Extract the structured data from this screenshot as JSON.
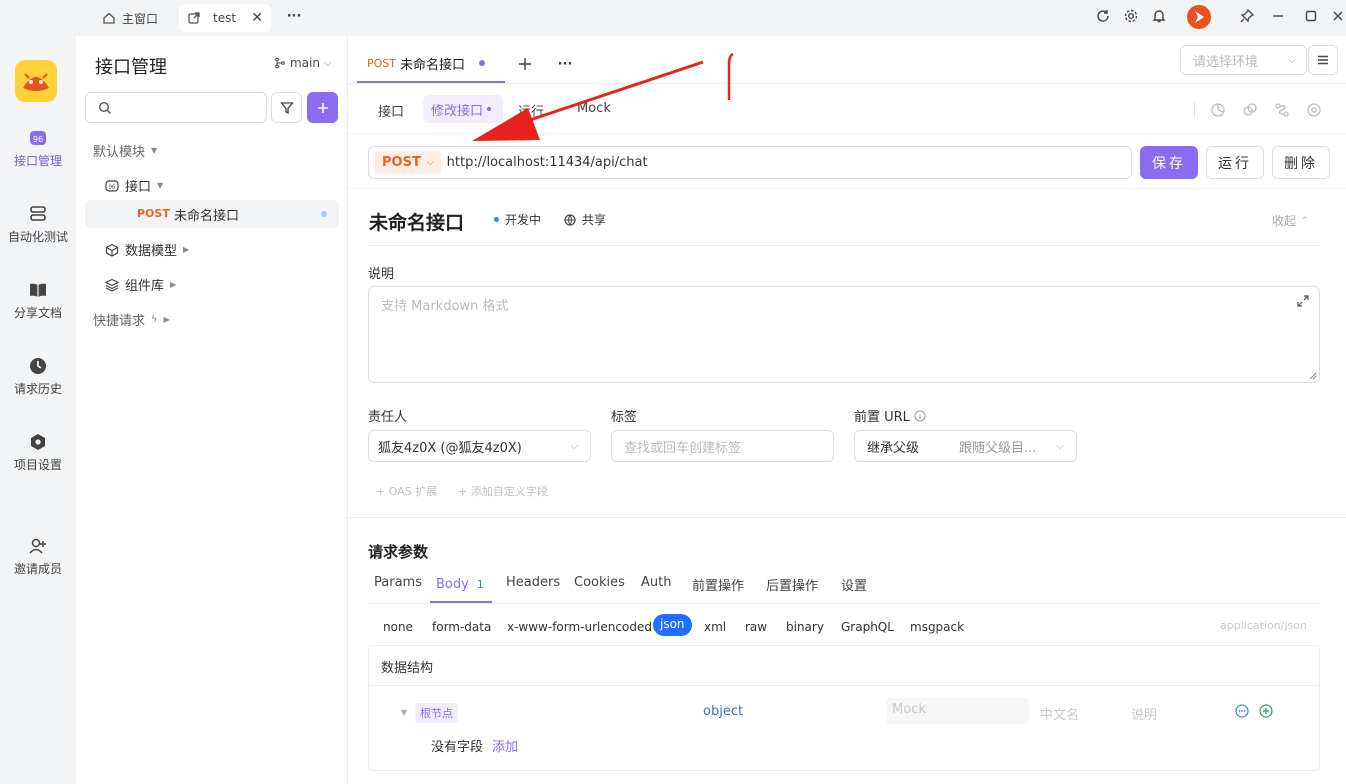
{
  "titlebar": {
    "tabs": [
      {
        "label": "主窗口"
      },
      {
        "label": "test"
      }
    ],
    "more": "···"
  },
  "rail": {
    "items": [
      {
        "label": "接口管理"
      },
      {
        "label": "自动化测试"
      },
      {
        "label": "分享文档"
      },
      {
        "label": "请求历史"
      },
      {
        "label": "项目设置"
      },
      {
        "label": "邀请成员"
      }
    ]
  },
  "sidebar": {
    "title": "接口管理",
    "branch": "main",
    "tree": {
      "default_module": "默认模块",
      "api_folder": "接口",
      "api_item_method": "POST",
      "api_item_name": "未命名接口",
      "data_model": "数据模型",
      "components": "组件库",
      "quick_request": "快捷请求"
    }
  },
  "main": {
    "doc_tab": {
      "method": "POST",
      "name": "未命名接口"
    },
    "env_select_placeholder": "请选择环境",
    "subtabs": [
      "接口",
      "修改接口",
      "运行",
      "Mock"
    ],
    "request": {
      "method": "POST",
      "url": "http://localhost:11434/api/chat",
      "save": "保存",
      "run": "运行",
      "delete": "删除"
    },
    "api": {
      "name": "未命名接口",
      "status": "开发中",
      "share": "共享",
      "collapse": "收起"
    },
    "description": {
      "label": "说明",
      "placeholder": "支持 Markdown 格式"
    },
    "owner": {
      "label": "责任人",
      "value": "狐友4z0X (@狐友4z0X)"
    },
    "tags": {
      "label": "标签",
      "placeholder": "查找或回车创建标签"
    },
    "prefix_url": {
      "label": "前置 URL",
      "mode": "继承父级",
      "value": "跟随父级目..."
    },
    "extras": {
      "oas": "+ OAS 扩展",
      "custom": "+ 添加自定义字段"
    },
    "params": {
      "title": "请求参数",
      "tabs": [
        "Params",
        "Body",
        "Headers",
        "Cookies",
        "Auth",
        "前置操作",
        "后置操作",
        "设置"
      ],
      "body_count": "1",
      "body_types": [
        "none",
        "form-data",
        "x-www-form-urlencoded",
        "json",
        "xml",
        "raw",
        "binary",
        "GraphQL",
        "msgpack"
      ],
      "content_type": "application/json",
      "schema_title": "数据结构",
      "root_node": "根节点",
      "root_type": "object",
      "mock_placeholder": "Mock",
      "cn_name_placeholder": "中文名",
      "desc_placeholder": "说明",
      "no_fields": "没有字段",
      "add": "添加"
    }
  },
  "colors": {
    "accent": "#8b6cf0",
    "post": "#e8641b",
    "annotation": "#e8231b"
  }
}
